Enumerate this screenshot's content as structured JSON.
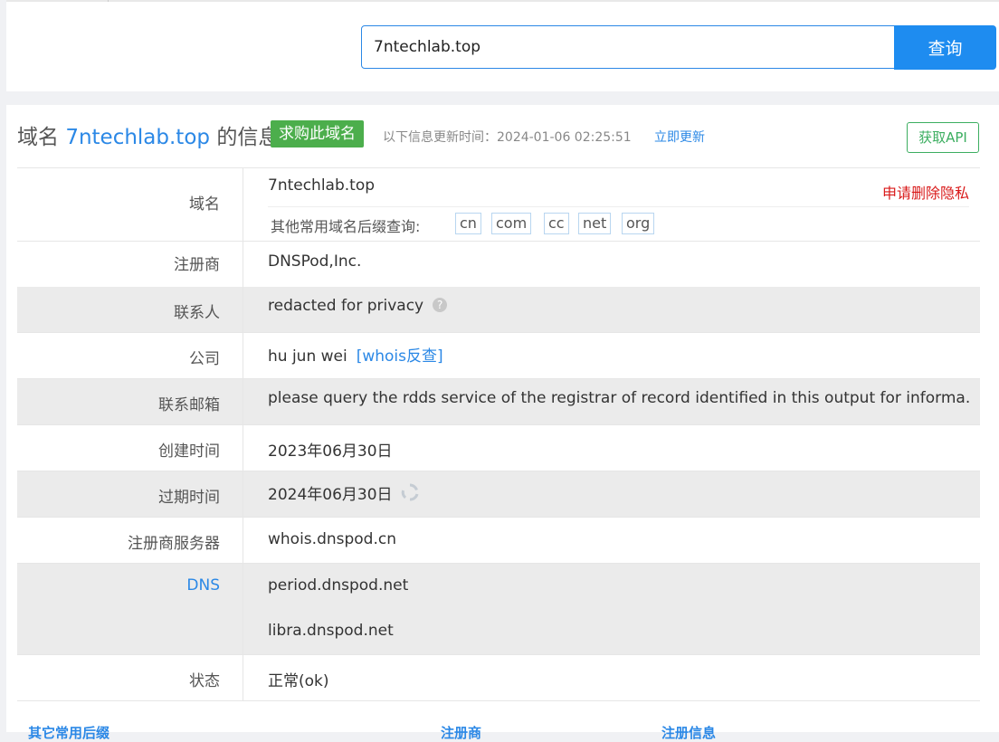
{
  "search": {
    "value": "7ntechlab.top",
    "button_label": "查询"
  },
  "header": {
    "title_prefix": "域名",
    "domain": "7ntechlab.top",
    "title_suffix": "的信息",
    "buy_label": "求购此域名",
    "update_time": "以下信息更新时间：2024-01-06 02:25:51",
    "update_link": "立即更新",
    "api_label": "获取API"
  },
  "info": {
    "domain_label": "域名",
    "domain_value": "7ntechlab.top",
    "privacy_delete": "申请删除隐私",
    "suffix_label": "其他常用域名后缀查询:",
    "suffixes": [
      "cn",
      "com",
      "cc",
      "net",
      "org"
    ],
    "registrar_label": "注册商",
    "registrar_value": "DNSPod,Inc.",
    "contact_label": "联系人",
    "contact_value": "redacted for privacy",
    "company_label": "公司",
    "company_value": "hu jun wei",
    "whois_reverse": "[whois反查]",
    "email_label": "联系邮箱",
    "email_value": "please query the rdds service of the registrar of record identified in this output for informa...",
    "created_label": "创建时间",
    "created_value": "2023年06月30日",
    "expire_label": "过期时间",
    "expire_value": "2024年06月30日",
    "server_label": "注册商服务器",
    "server_value": "whois.dnspod.cn",
    "dns_label": "DNS",
    "dns_values": [
      "period.dnspod.net",
      "libra.dnspod.net"
    ],
    "status_label": "状态",
    "status_value": "正常(ok)"
  },
  "bottom_tabs": [
    "其它常用后缀",
    "注册商",
    "注册信息"
  ],
  "colors": {
    "accent": "#2b88e6",
    "button": "#1e8cf0",
    "buy_badge": "#4cae4c",
    "api_border": "#3cae60",
    "privacy": "#d91a1a",
    "row_gray": "#ebebeb"
  }
}
